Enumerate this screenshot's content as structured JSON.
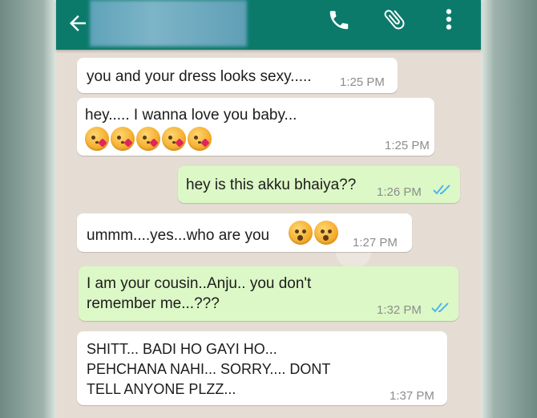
{
  "header": {
    "back_icon": "arrow-back-icon",
    "contact_name_blurred": true,
    "actions": [
      "phone-icon",
      "paperclip-icon",
      "more-vert-icon"
    ]
  },
  "colors": {
    "header": "#0b7a6b",
    "incoming_bubble": "#ffffff",
    "outgoing_bubble": "#dcf8c6",
    "read_ticks": "#4fb6ec",
    "chat_background": "#e5ddd3"
  },
  "messages": [
    {
      "direction": "incoming",
      "text": "you and your dress looks sexy.....",
      "time": "1:25 PM"
    },
    {
      "direction": "incoming",
      "text": "hey..... I wanna love you baby...",
      "emojis": [
        "kissing-heart",
        "kissing-heart",
        "kissing-heart",
        "kissing-heart",
        "kissing-heart"
      ],
      "time": "1:25 PM"
    },
    {
      "direction": "outgoing",
      "text": "hey is this akku bhaiya??",
      "time": "1:26 PM",
      "status": "read"
    },
    {
      "direction": "incoming",
      "text": "ummm....yes...who are you",
      "emojis": [
        "hushed",
        "hushed"
      ],
      "time": "1:27 PM"
    },
    {
      "direction": "outgoing",
      "lines": [
        "I am your cousin..Anju.. you don't",
        "remember me...???"
      ],
      "time": "1:32 PM",
      "status": "read"
    },
    {
      "direction": "incoming",
      "lines": [
        "SHITT... BADI HO GAYI HO...",
        "PEHCHANA NAHI... SORRY.... DONT",
        "TELL ANYONE PLZZ..."
      ],
      "time": "1:37 PM"
    }
  ]
}
